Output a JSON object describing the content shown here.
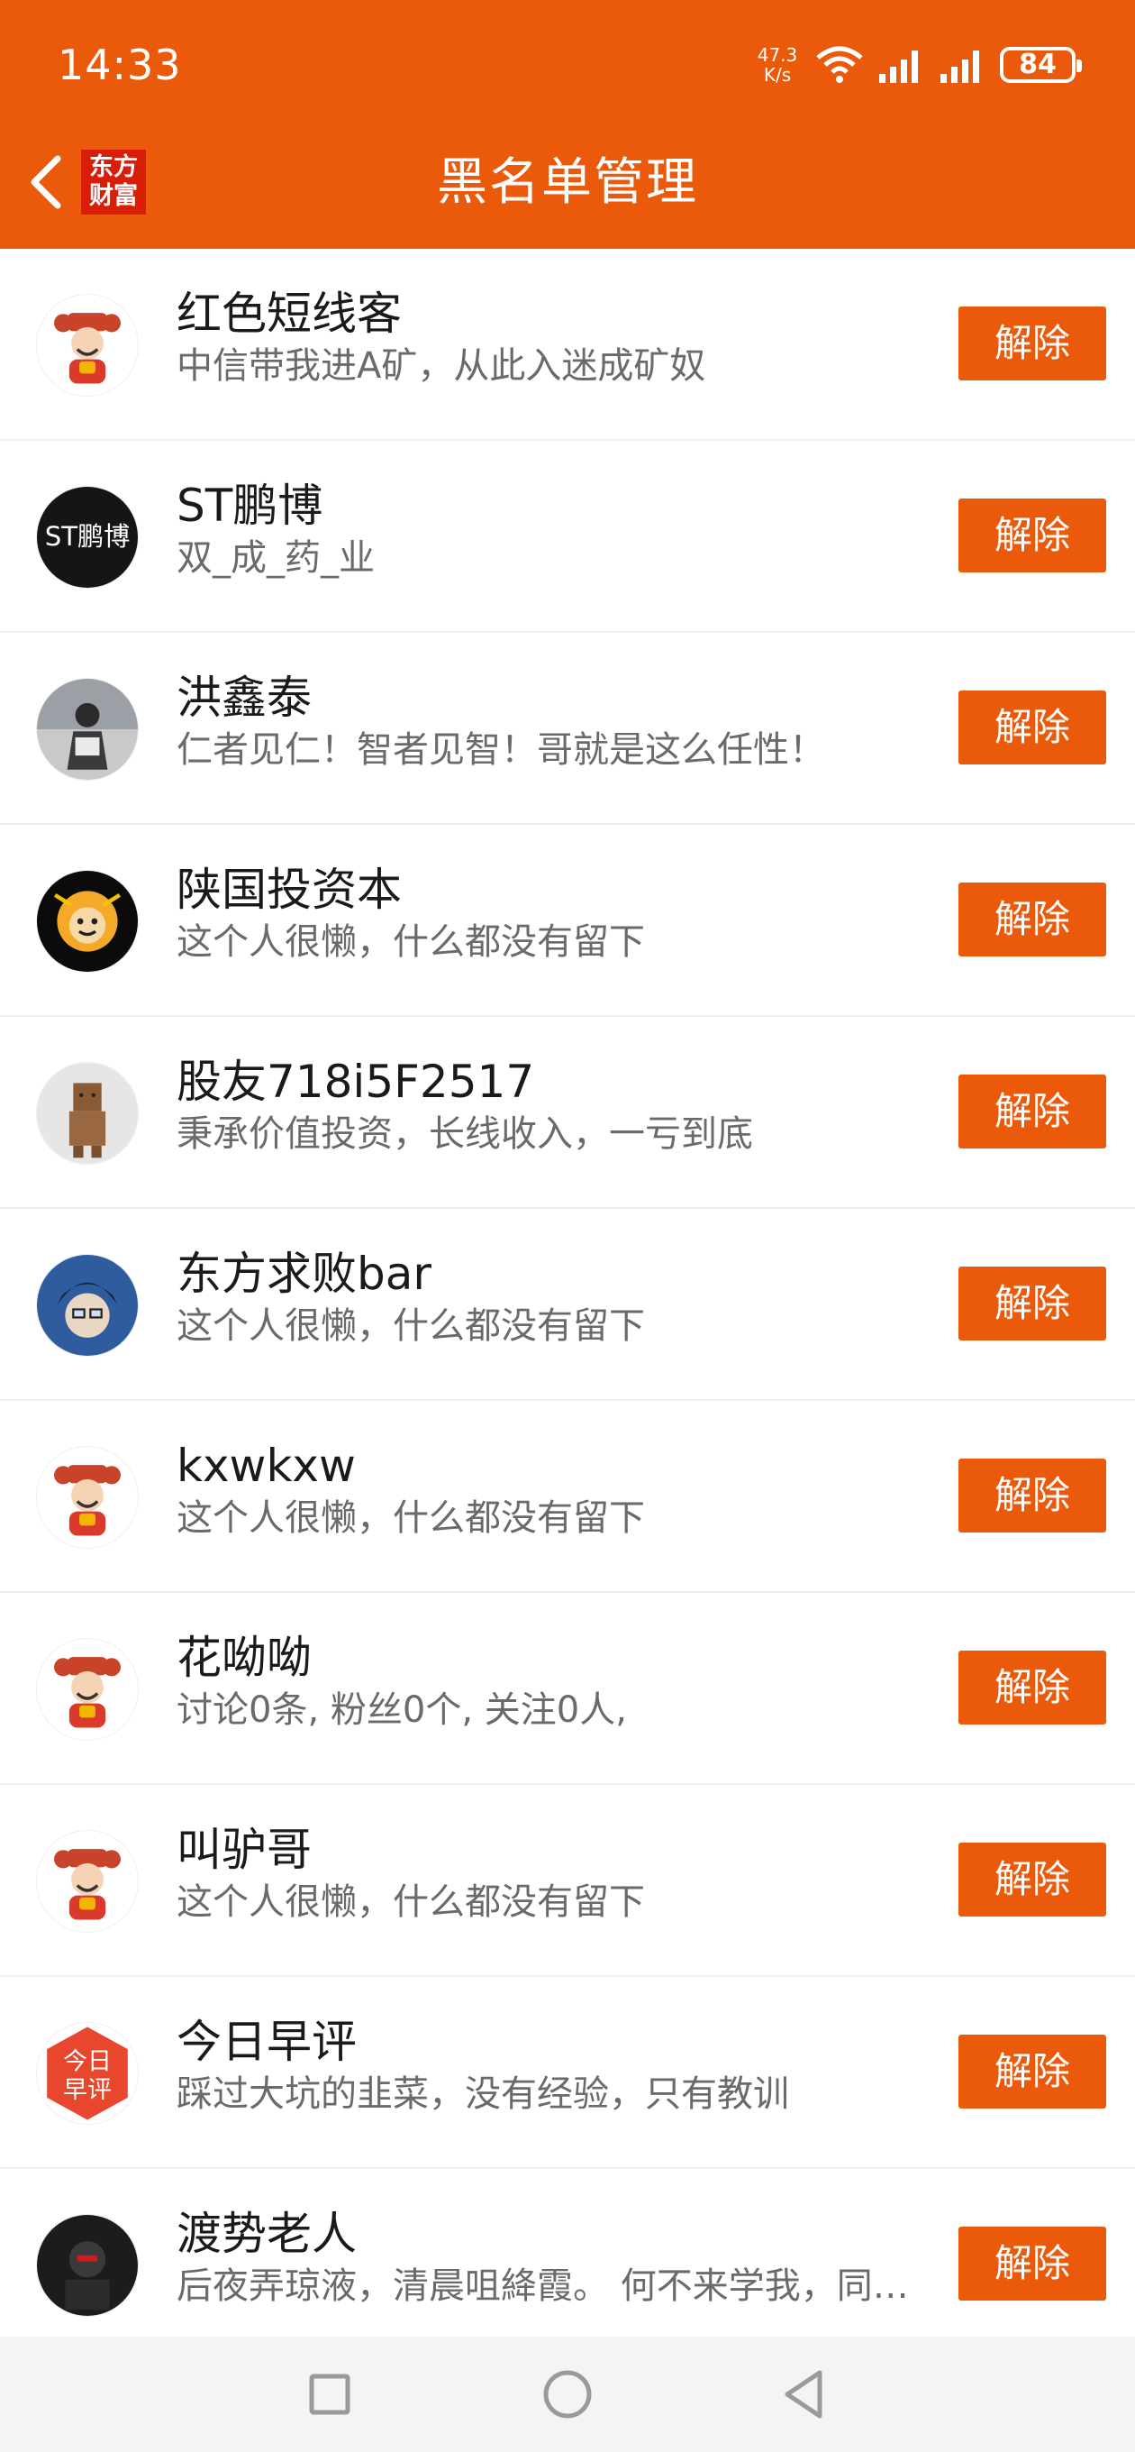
{
  "status_bar": {
    "time": "14:33",
    "net_speed_top": "47.3",
    "net_speed_bottom": "K/s",
    "battery": "84"
  },
  "header": {
    "title": "黑名单管理",
    "logo_line1": "东方",
    "logo_line2": "财富",
    "back_icon": "chevron-left-icon"
  },
  "colors": {
    "brand": "#EA5A0A",
    "name_text": "#1a1a1a",
    "bio_text": "#6a6a6a"
  },
  "users": [
    {
      "name": "红色短线客",
      "bio": "中信带我进A矿，从此入迷成矿奴",
      "action": "解除",
      "avatar": "caishen"
    },
    {
      "name": "ST鹏博",
      "bio": "双_成_药_业",
      "action": "解除",
      "avatar": "st",
      "avatar_text": "ST鹏博"
    },
    {
      "name": "洪鑫泰",
      "bio": "仁者见仁！智者见智！哥就是这么任性！",
      "action": "解除",
      "avatar": "photo"
    },
    {
      "name": "陕国投资本",
      "bio": "这个人很懒，什么都没有留下",
      "action": "解除",
      "avatar": "monkey"
    },
    {
      "name": "股友718i5F2517",
      "bio": "秉承价值投资，长线收入，一亏到底",
      "action": "解除",
      "avatar": "box"
    },
    {
      "name": "东方求败bar",
      "bio": "这个人很懒，什么都没有留下",
      "action": "解除",
      "avatar": "anime"
    },
    {
      "name": "kxwkxw",
      "bio": "这个人很懒，什么都没有留下",
      "action": "解除",
      "avatar": "caishen"
    },
    {
      "name": "花呦呦",
      "bio": "讨论0条, 粉丝0个, 关注0人,",
      "action": "解除",
      "avatar": "caishen"
    },
    {
      "name": "叫驴哥",
      "bio": "这个人很懒，什么都没有留下",
      "action": "解除",
      "avatar": "caishen"
    },
    {
      "name": "今日早评",
      "bio": "踩过大坑的韭菜，没有经验，只有教训",
      "action": "解除",
      "avatar": "zaoping",
      "avatar_text_1": "今日",
      "avatar_text_2": "早评"
    },
    {
      "name": "渡势老人",
      "bio": "后夜弄琼液，清晨咀絳霞。 何不来学我，同…",
      "action": "解除",
      "avatar": "dark"
    }
  ],
  "nav": {
    "recent_icon": "square-icon",
    "home_icon": "circle-icon",
    "back_icon": "triangle-back-icon"
  }
}
